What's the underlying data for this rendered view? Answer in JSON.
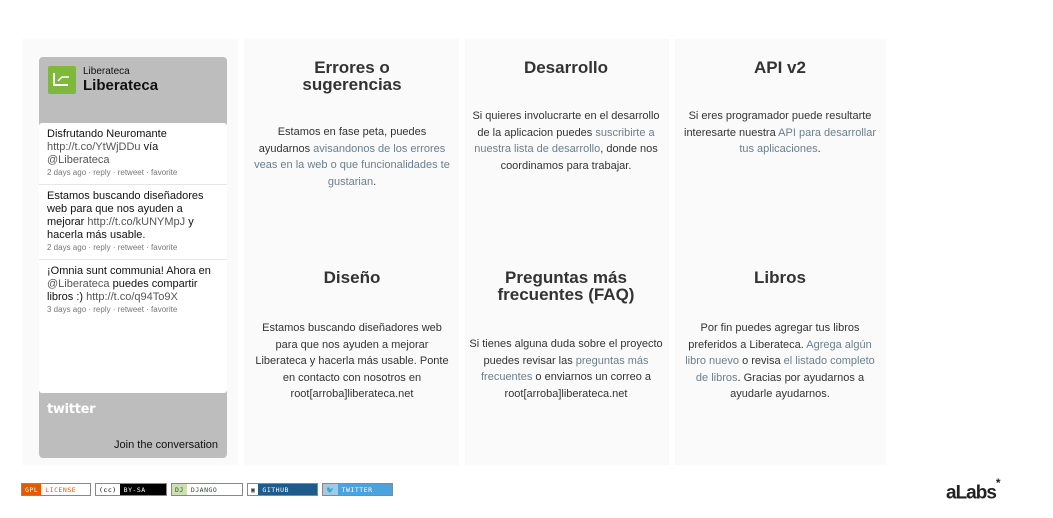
{
  "widget": {
    "account_small": "Liberateca",
    "account_name": "Liberateca",
    "tweets": [
      {
        "text": "Disfrutando Neuromante ",
        "link": "http://t.co/YtWjDDu",
        "after": " vía ",
        "mention": "@Liberateca",
        "meta": "2 days ago · reply · retweet · favorite"
      },
      {
        "text": "Estamos buscando diseñadores web para que nos ayuden a mejorar ",
        "link": "http://t.co/kUNYMpJ",
        "after": " y hacerla más usable.",
        "meta": "2 days ago · reply · retweet · favorite"
      },
      {
        "text": "¡Omnia sunt communia! Ahora en ",
        "mention": "@Liberateca",
        "after": " puedes compartir libros :) ",
        "link": "http://t.co/q94To9X",
        "meta": "3 days ago · reply · retweet · favorite"
      }
    ],
    "twitter_logo": "twitter",
    "join": "Join the conversation"
  },
  "cards": {
    "errores": {
      "title_line1": "Errores o",
      "title_line2": "sugerencias",
      "t1": "Estamos en fase peta, puedes ayudarnos ",
      "l1": "avisandonos de los errores veas en la web o que funcionalidades te gustarian",
      "t2": "."
    },
    "desarrollo": {
      "title": "Desarrollo",
      "t1": "Si quieres involucrarte en el desarrollo de la aplicacion puedes ",
      "l1": "suscribirte a nuestra lista de desarrollo",
      "t2": ", donde nos coordinamos para trabajar."
    },
    "api": {
      "title": "API v2",
      "t1": "Si eres programador puede resultarte interesarte nuestra ",
      "l1": "API para desarrollar tus aplicaciones",
      "t2": "."
    },
    "diseno": {
      "title": "Diseño",
      "t1": "Estamos buscando diseñadores web para que nos ayuden a mejorar Liberateca y hacerla más usable. Ponte en contacto con nosotros en root[arroba]liberateca.net"
    },
    "faq": {
      "title_line1": "Preguntas más",
      "title_line2": "frecuentes (FAQ)",
      "t1": "Si tienes alguna duda sobre el proyecto puedes revisar las ",
      "l1": "preguntas más frecuentes",
      "t2": " o enviarnos un correo a root[arroba]liberateca.net"
    },
    "libros": {
      "title": "Libros",
      "t1": "Por fin puedes agregar tus libros preferidos a Liberateca. ",
      "l1": "Agrega algún libro nuevo",
      "t2": " o revisa ",
      "l2": "el listado completo de libros",
      "t3": ". Gracias por ayudarnos a ayudarle ayudarnos."
    }
  },
  "footer": {
    "badges": [
      {
        "left": "GPL",
        "right": "LICENSE",
        "lc": "#e05a00",
        "rc": "#ffffff",
        "lt": "#ffffff",
        "rt": "#e05a00"
      },
      {
        "left": "(cc)",
        "right": "BY-SA",
        "lc": "#ffffff",
        "rc": "#000000",
        "lt": "#000000",
        "rt": "#ffffff"
      },
      {
        "left": "DJ",
        "right": "DJANGO",
        "lc": "#cfe0b0",
        "rc": "#ffffff",
        "lt": "#234f32",
        "rt": "#234f32"
      },
      {
        "left": "▣",
        "right": "GITHUB",
        "lc": "#ffffff",
        "rc": "#1e5a8a",
        "lt": "#333333",
        "rt": "#ffffff"
      },
      {
        "left": "🐦",
        "right": "TWITTER",
        "lc": "#9fcbe8",
        "rc": "#4aa3df",
        "lt": "#ffffff",
        "rt": "#ffffff"
      }
    ],
    "brand": "aLabs",
    "brand_mark": "*"
  }
}
